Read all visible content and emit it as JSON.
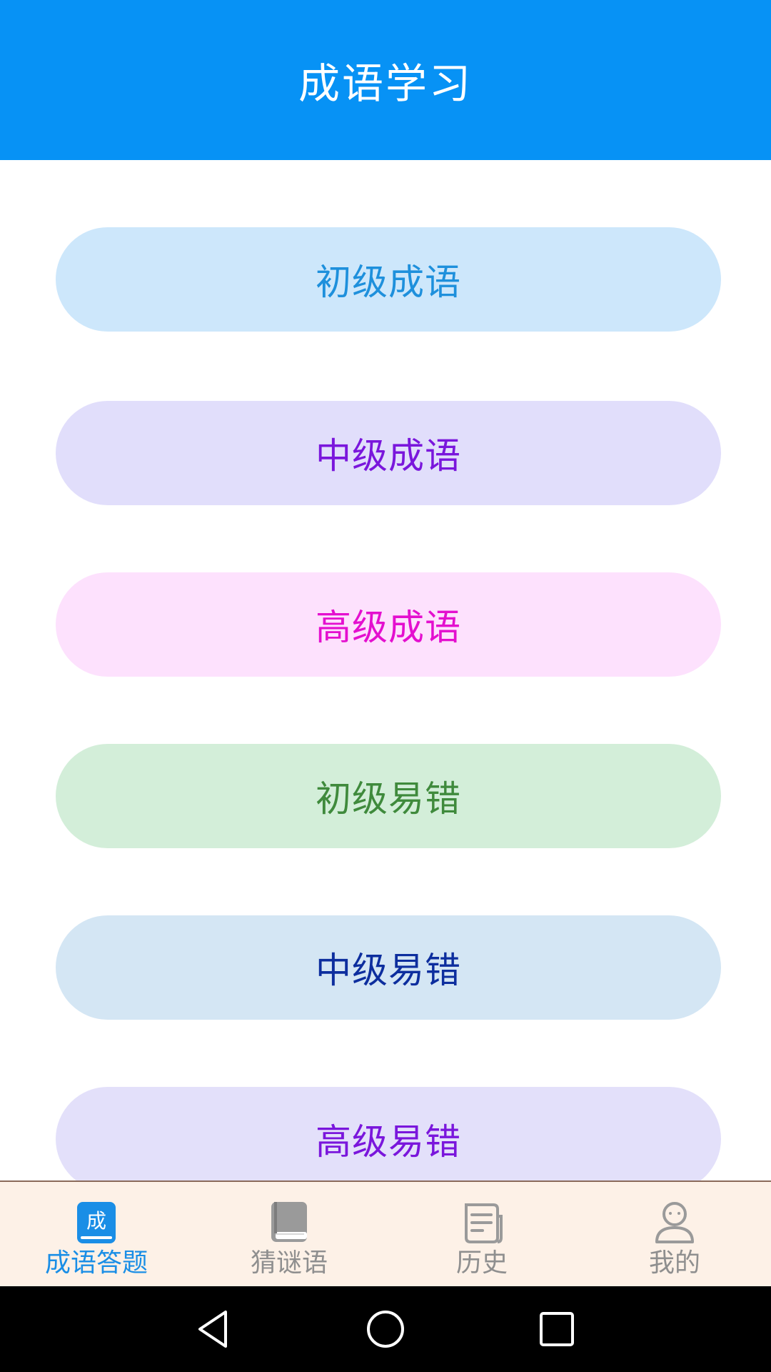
{
  "header": {
    "title": "成语学习"
  },
  "levels": [
    {
      "label": "初级成语",
      "bg": "#cde7fb",
      "fg": "#1e90dc"
    },
    {
      "label": "中级成语",
      "bg": "#e1defb",
      "fg": "#7a16dc"
    },
    {
      "label": "高级成语",
      "bg": "#fde1fd",
      "fg": "#e40fcf"
    },
    {
      "label": "初级易错",
      "bg": "#d3eed9",
      "fg": "#3f8a3c"
    },
    {
      "label": "中级易错",
      "bg": "#d4e6f4",
      "fg": "#0d2e9e"
    },
    {
      "label": "高级易错",
      "bg": "#e3e0fa",
      "fg": "#7a16dc"
    }
  ],
  "tabbar": {
    "tabs": [
      {
        "label": "成语答题",
        "icon": "idiom-quiz-icon",
        "icon_text": "成",
        "active": true
      },
      {
        "label": "猜谜语",
        "icon": "book-icon",
        "active": false
      },
      {
        "label": "历史",
        "icon": "document-icon",
        "active": false
      },
      {
        "label": "我的",
        "icon": "user-icon",
        "active": false
      }
    ],
    "active_color": "#1a8ee6",
    "inactive_color": "#8f8f8f",
    "bg": "#fdf1e7"
  },
  "navbar": {
    "buttons": [
      "back-icon",
      "home-icon",
      "recents-icon"
    ]
  }
}
